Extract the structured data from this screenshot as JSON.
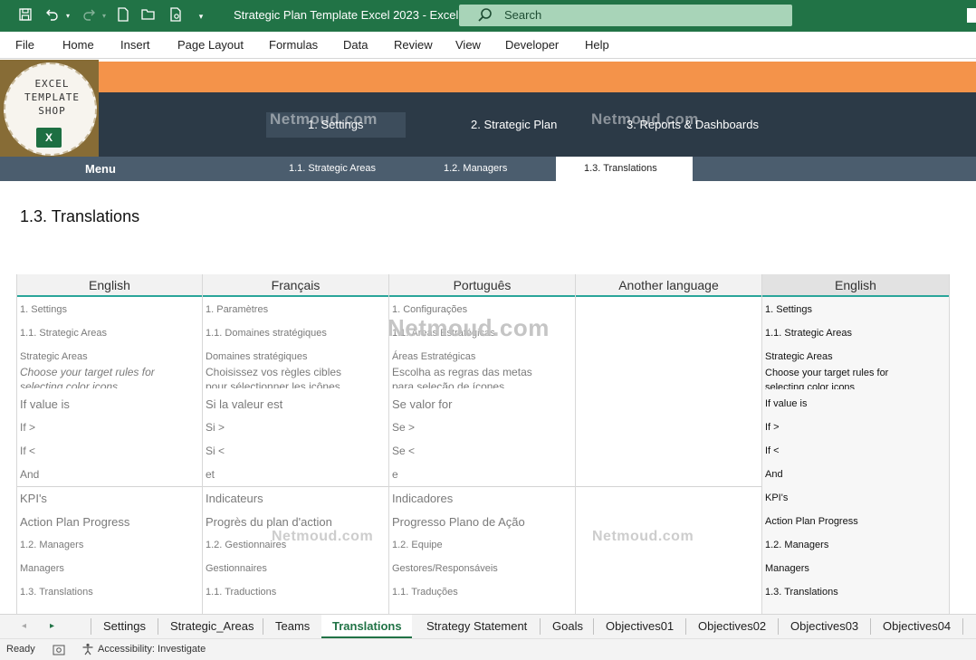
{
  "window": {
    "title": "Strategic Plan Template Excel 2023  -  Excel",
    "search_placeholder": "Search"
  },
  "quick_access": [
    "save-icon",
    "undo-icon",
    "redo-icon",
    "new-icon",
    "open-icon",
    "print-preview-icon",
    "customize-icon"
  ],
  "menu": [
    "File",
    "Home",
    "Insert",
    "Page Layout",
    "Formulas",
    "Data",
    "Review",
    "View",
    "Developer",
    "Help"
  ],
  "logo": {
    "line1": "EXCEL",
    "line2": "TEMPLATE",
    "line3": "SHOP",
    "mark": "X"
  },
  "nav": {
    "settings": "1. Settings",
    "strategic_plan": "2. Strategic Plan",
    "reports": "3. Reports & Dashboards",
    "menu": "Menu",
    "sub1": "1.1. Strategic Areas",
    "sub2": "1.2. Managers",
    "sub3": "1.3. Translations"
  },
  "watermark": "Netmoud.com",
  "page_title": "1.3. Translations",
  "table": {
    "headers": [
      "English",
      "Français",
      "Português",
      "Another language",
      "English"
    ],
    "english": [
      "1. Settings",
      "1.1. Strategic Areas",
      "Strategic Areas",
      "Choose your target rules for",
      "selecting color icons",
      "If value is",
      "If >",
      "If <",
      "And",
      "KPI's",
      "Action Plan Progress",
      "1.2. Managers",
      "Managers",
      "1.3. Translations"
    ],
    "french": [
      "1. Paramètres",
      "1.1. Domaines stratégiques",
      "Domaines stratégiques",
      "Choisissez vos règles cibles",
      "pour sélectionner les icônes",
      "Si la valeur est",
      "Si >",
      "Si <",
      "et",
      "Indicateurs",
      "Progrès du plan d'action",
      "1.2. Gestionnaires",
      "Gestionnaires",
      "1.1. Traductions"
    ],
    "portuguese": [
      "1. Configurações",
      "1.1. Áreas Estratégicas",
      "Áreas Estratégicas",
      "Escolha as regras das metas",
      "para seleção de ícones",
      "Se valor for",
      "Se >",
      "Se <",
      "e",
      "Indicadores",
      "Progresso Plano de Ação",
      "1.2. Equipe",
      "Gestores/Responsáveis",
      "1.1. Traduções"
    ],
    "result": [
      "1. Settings",
      "1.1. Strategic Areas",
      "Strategic Areas",
      "Choose your target rules for",
      "selecting color icons",
      "If value is",
      "If >",
      "If <",
      "And",
      "KPI's",
      "Action Plan Progress",
      "1.2. Managers",
      "Managers",
      "1.3. Translations"
    ]
  },
  "sheet_tabs": [
    "Settings",
    "Strategic_Areas",
    "Teams",
    "Translations",
    "Strategy Statement",
    "Goals",
    "Objectives01",
    "Objectives02",
    "Objectives03",
    "Objectives04"
  ],
  "status": {
    "ready": "Ready",
    "accessibility": "Accessibility: Investigate"
  },
  "colors": {
    "excel_green": "#217346",
    "orange": "#f4934a",
    "dark_nav": "#2c3a47",
    "sub_nav": "#4b5d6e",
    "teal_rule": "#2aa59a"
  }
}
